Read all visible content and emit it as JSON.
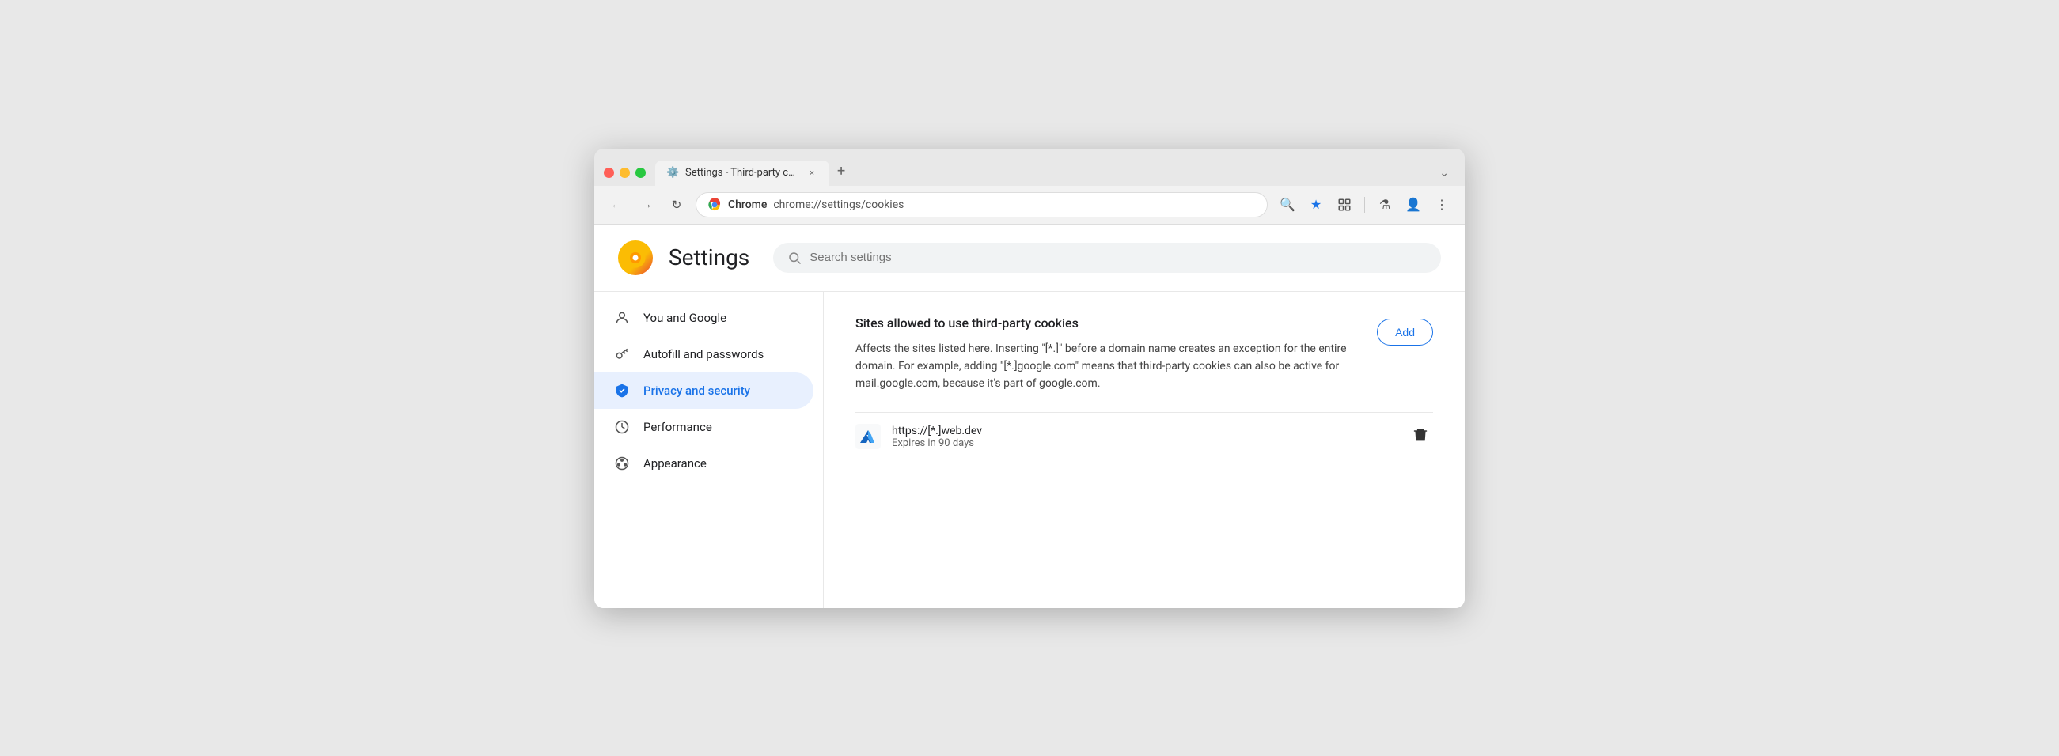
{
  "browser": {
    "tab": {
      "label": "Settings - Third-party cookie",
      "favicon": "⚙️"
    },
    "tab_close": "×",
    "tab_new": "+",
    "tab_dropdown": "⌄"
  },
  "nav": {
    "back_label": "←",
    "forward_label": "→",
    "reload_label": "↻",
    "address": {
      "origin": "Chrome",
      "path": "chrome://settings/cookies"
    },
    "icons": {
      "zoom": "🔍",
      "bookmark": "★",
      "extension": "🧩",
      "lab": "⚗",
      "profile": "👤",
      "menu": "⋮"
    }
  },
  "settings": {
    "logo": "☀",
    "title": "Settings",
    "search_placeholder": "Search settings"
  },
  "sidebar": {
    "items": [
      {
        "id": "you-and-google",
        "label": "You and Google",
        "icon": "👤"
      },
      {
        "id": "autofill",
        "label": "Autofill and passwords",
        "icon": "🔑"
      },
      {
        "id": "privacy",
        "label": "Privacy and security",
        "icon": "🛡",
        "active": true
      },
      {
        "id": "performance",
        "label": "Performance",
        "icon": "⏱"
      },
      {
        "id": "appearance",
        "label": "Appearance",
        "icon": "🎨"
      }
    ]
  },
  "main": {
    "section_title": "Sites allowed to use third-party cookies",
    "section_desc": "Affects the sites listed here. Inserting \"[*.]\" before a domain name creates an exception for the entire domain. For example, adding \"[*.]google.com\" means that third-party cookies can also be active for mail.google.com, because it's part of google.com.",
    "add_button_label": "Add",
    "site": {
      "url": "https://[*.]web.dev",
      "expiry": "Expires in 90 days"
    },
    "delete_icon": "🗑"
  }
}
